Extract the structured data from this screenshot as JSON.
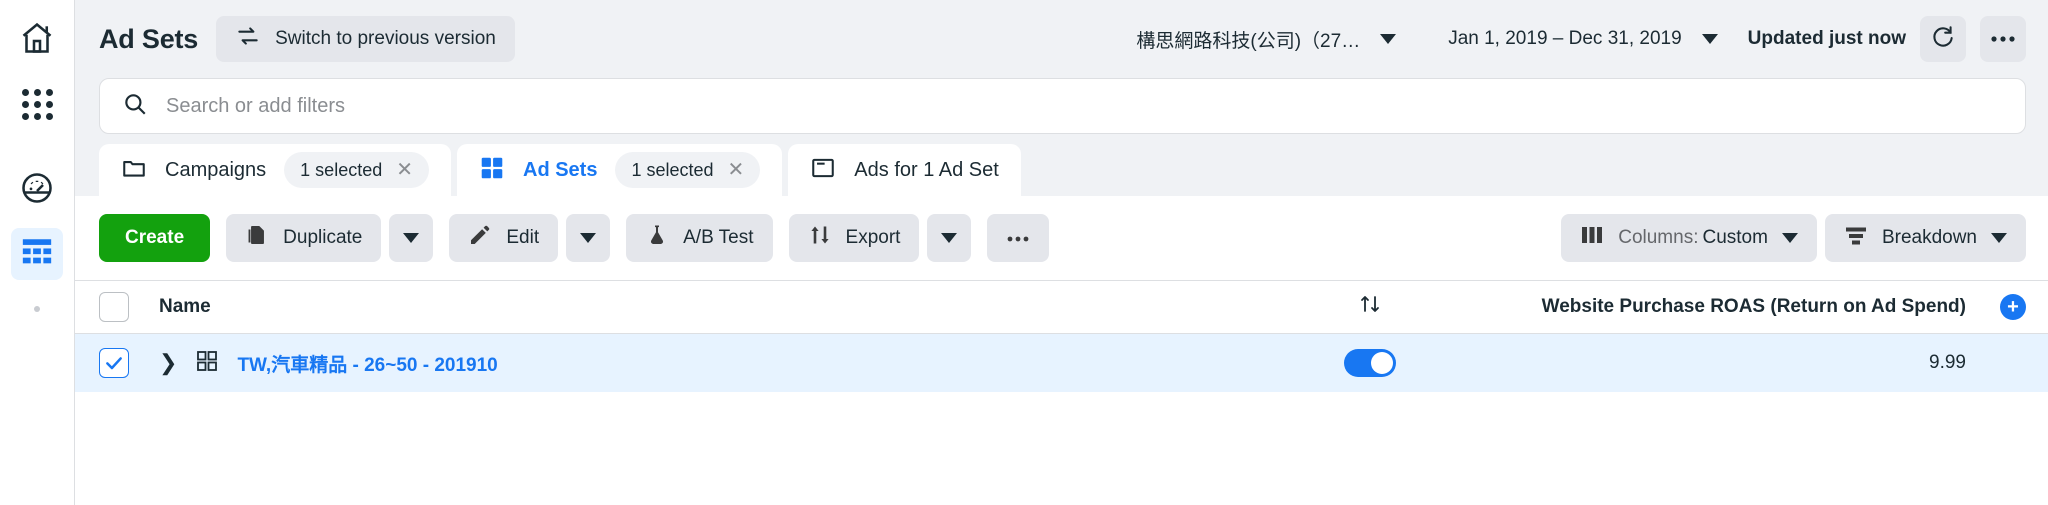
{
  "sidebar": {
    "items": [
      {
        "name": "home-icon",
        "label": "Home",
        "active": false
      },
      {
        "name": "apps-grid-icon",
        "label": "All Tools",
        "active": false
      },
      {
        "name": "gauge-icon",
        "label": "Performance",
        "active": false
      },
      {
        "name": "table-icon",
        "label": "Ads Manager",
        "active": true
      }
    ]
  },
  "header": {
    "title": "Ad Sets",
    "switch_version_label": "Switch to previous version",
    "switch_icon": "swap-icon",
    "account_name": "構思網路科技(公司)（27…",
    "date_range": "Jan 1, 2019 – Dec 31, 2019",
    "updated_label": "Updated just now",
    "refresh_icon": "refresh-icon",
    "more_icon": "ellipsis-icon"
  },
  "search": {
    "placeholder": "Search or add filters",
    "value": "",
    "icon": "search-icon"
  },
  "tabs": [
    {
      "label": "Campaigns",
      "icon": "folder-icon",
      "badge": "1 selected",
      "active": false
    },
    {
      "label": "Ad Sets",
      "icon": "four-squares-icon",
      "badge": "1 selected",
      "active": true
    },
    {
      "label": "Ads for 1 Ad Set",
      "icon": "window-icon",
      "badge": "",
      "active": false
    }
  ],
  "toolbar": {
    "create_label": "Create",
    "duplicate_label": "Duplicate",
    "duplicate_icon": "copy-icon",
    "edit_label": "Edit",
    "edit_icon": "pencil-icon",
    "abtest_label": "A/B Test",
    "abtest_icon": "flask-icon",
    "export_label": "Export",
    "export_icon": "updown-arrows-icon",
    "more_label": "•••",
    "caret_icon": "chevron-down-icon",
    "columns_prefix": "Columns: ",
    "columns_value": "Custom",
    "columns_icon": "columns-icon",
    "breakdown_label": "Breakdown",
    "breakdown_icon": "breakdown-icon"
  },
  "table": {
    "columns": {
      "name": "Name",
      "sort_icon": "sort-icon",
      "roas": "Website Purchase ROAS (Return on Ad Spend)",
      "add_column_icon": "plus-icon"
    },
    "rows": [
      {
        "checked": true,
        "expand_icon": "chevron-right-icon",
        "row_icon": "four-squares-icon",
        "name": "TW,汽車精品 - 26~50 - 201910",
        "toggle_on": true,
        "roas": "9.99"
      }
    ]
  },
  "colors": {
    "accent_blue": "#1877f2",
    "create_green": "#13a10e",
    "row_highlight": "#e7f3ff",
    "chrome_gray": "#f0f2f5"
  }
}
